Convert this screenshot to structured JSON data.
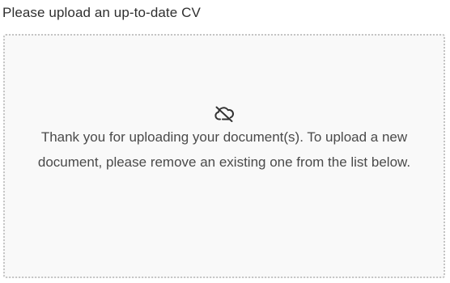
{
  "upload": {
    "label": "Please upload an up-to-date CV",
    "icon": "cloud-off-icon",
    "message": "Thank you for uploading your document(s). To upload a new document, please remove an existing one from the list below."
  }
}
